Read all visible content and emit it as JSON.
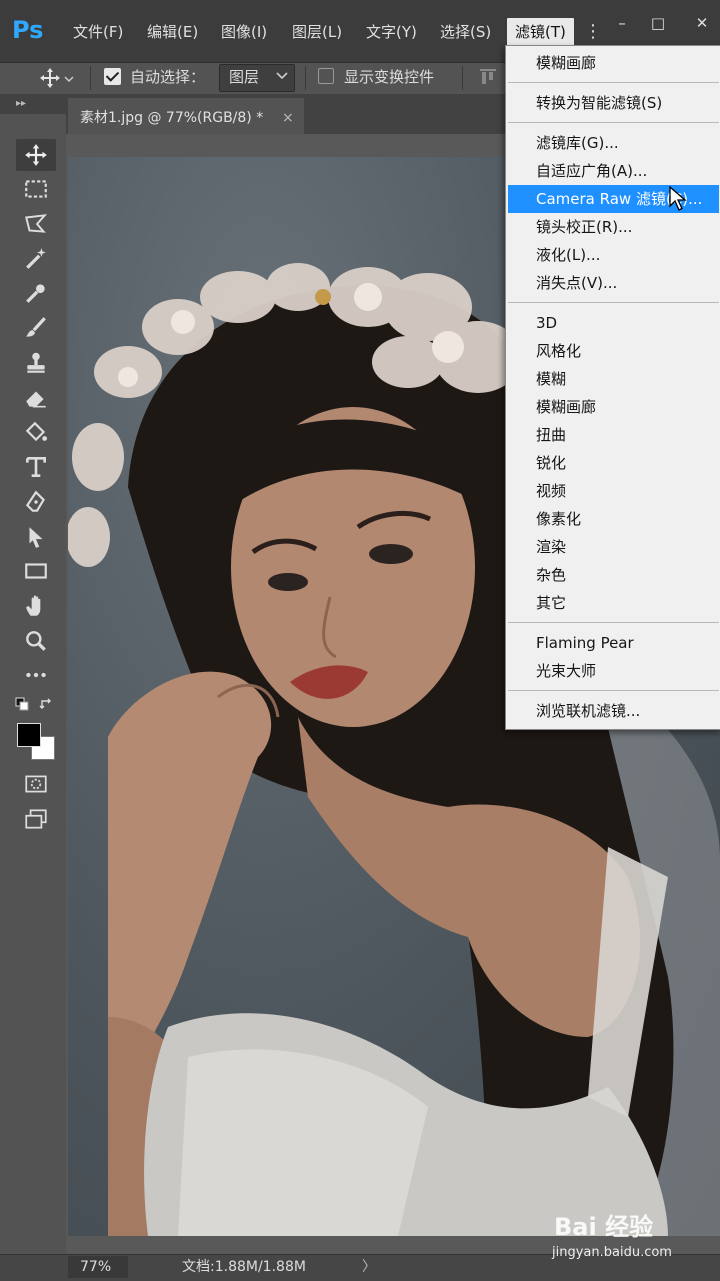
{
  "app": {
    "logo": "Ps"
  },
  "menubar": {
    "items": [
      "文件(F)",
      "编辑(E)",
      "图像(I)",
      "图层(L)",
      "文字(Y)",
      "选择(S)",
      "滤镜(T)"
    ],
    "more": "⋮",
    "window_controls": {
      "minimize": "–",
      "restore": "□",
      "close": "✕"
    }
  },
  "options_bar": {
    "auto_select_label": "自动选择：",
    "auto_select_checked": true,
    "layer_select_value": "图层",
    "show_transform_label": "显示变换控件",
    "show_transform_checked": false
  },
  "toolbar": {
    "tools": [
      "move-tool",
      "marquee-tool",
      "lasso-tool",
      "magic-wand-tool",
      "eyedropper-tool",
      "brush-tool",
      "stamp-tool",
      "eraser-tool",
      "paint-bucket-tool",
      "type-tool",
      "pen-tool",
      "path-select-tool",
      "rectangle-tool",
      "hand-tool",
      "zoom-tool",
      "more-tools"
    ],
    "foreground_color": "#000000",
    "background_color": "#ffffff"
  },
  "document": {
    "tab_title": "素材1.jpg @ 77%(RGB/8) *",
    "close_glyph": "×"
  },
  "status_bar": {
    "zoom": "77%",
    "doc_info": "文档:1.88M/1.88M",
    "arrow": "〉"
  },
  "filter_menu": {
    "groups": [
      [
        "模糊画廊"
      ],
      [
        "转换为智能滤镜(S)"
      ],
      [
        "滤镜库(G)...",
        "自适应广角(A)...",
        "Camera Raw 滤镜(C)...",
        "镜头校正(R)...",
        "液化(L)...",
        "消失点(V)..."
      ],
      [
        "3D",
        "风格化",
        "模糊",
        "模糊画廊",
        "扭曲",
        "锐化",
        "视频",
        "像素化",
        "渲染",
        "杂色",
        "其它"
      ],
      [
        "Flaming Pear",
        "光束大师"
      ],
      [
        "浏览联机滤镜..."
      ]
    ],
    "highlighted": "Camera Raw 滤镜(C)...",
    "highlight_color": "#1e90ff"
  },
  "watermark": {
    "logo": "Bai 经验",
    "url": "jingyan.baidu.com"
  }
}
